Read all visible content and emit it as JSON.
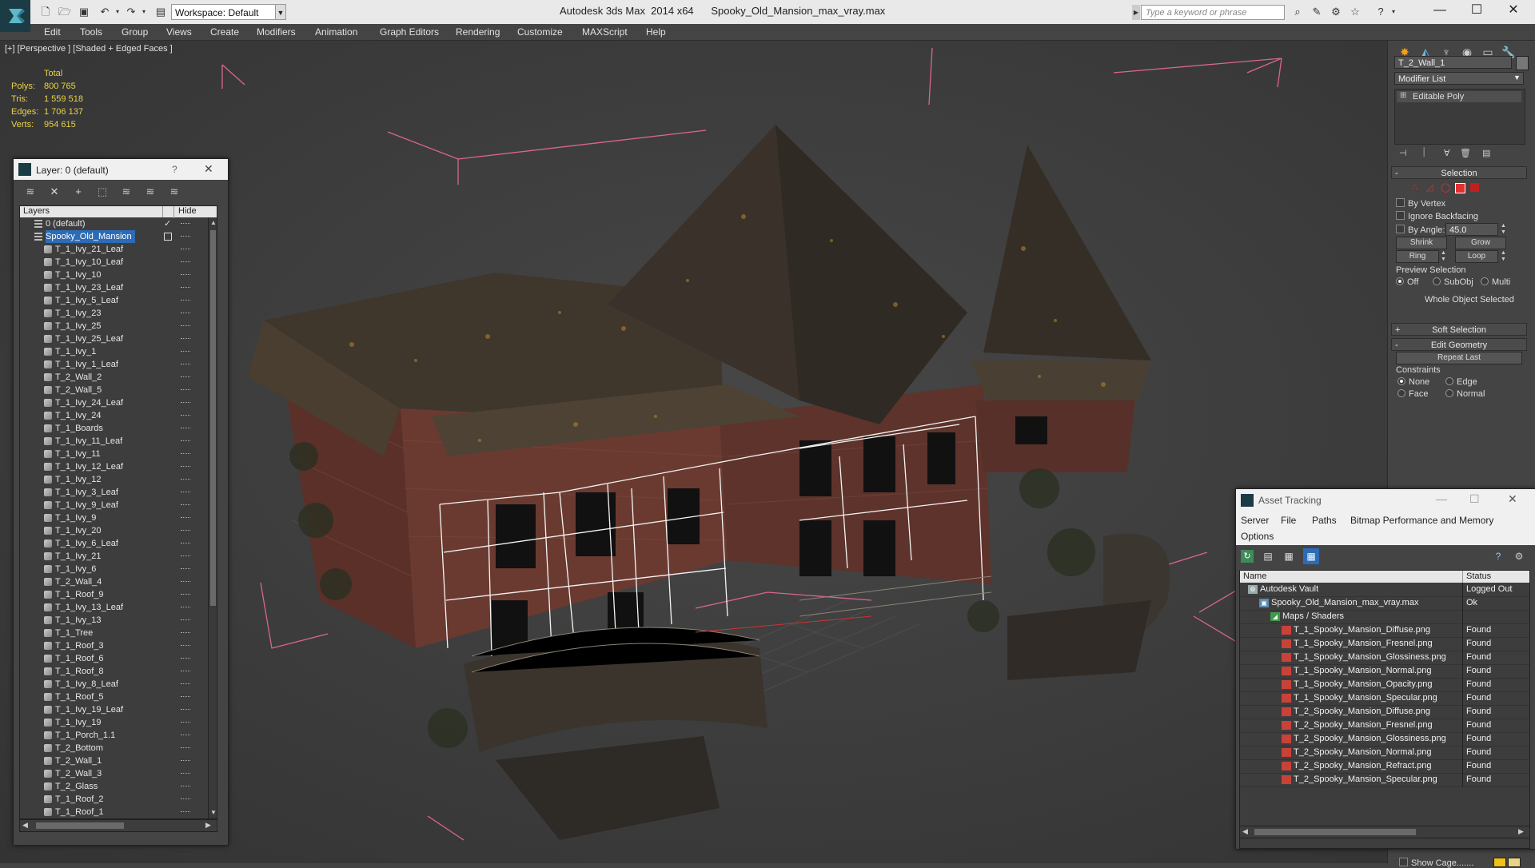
{
  "app": {
    "title": "Autodesk 3ds Max  2014 x64      Spooky_Old_Mansion_max_vray.max",
    "workspace": "Workspace: Default",
    "search_placeholder": "Type a keyword or phrase"
  },
  "menu": [
    "Edit",
    "Tools",
    "Group",
    "Views",
    "Create",
    "Modifiers",
    "Animation",
    "Graph Editors",
    "Rendering",
    "Customize",
    "MAXScript",
    "Help"
  ],
  "viewport": {
    "label": "[+] [Perspective ] [Shaded + Edged Faces ]",
    "stats": {
      "header": "Total",
      "rows": [
        {
          "key": "Polys:",
          "value": "800 765"
        },
        {
          "key": "Tris:",
          "value": "1 559 518"
        },
        {
          "key": "Edges:",
          "value": "1 706 137"
        },
        {
          "key": "Verts:",
          "value": "954 615"
        }
      ]
    }
  },
  "layer_dialog": {
    "title": "Layer: 0 (default)",
    "help": "?",
    "col_layers": "Layers",
    "col_hide": "Hide",
    "rows": [
      {
        "name": "0 (default)",
        "level": 1,
        "checked": true
      },
      {
        "name": "Spooky_Old_Mansion",
        "level": 1,
        "selected": true
      },
      {
        "name": "T_1_Ivy_21_Leaf",
        "level": 2
      },
      {
        "name": "T_1_Ivy_10_Leaf",
        "level": 2
      },
      {
        "name": "T_1_Ivy_10",
        "level": 2
      },
      {
        "name": "T_1_Ivy_23_Leaf",
        "level": 2
      },
      {
        "name": "T_1_Ivy_5_Leaf",
        "level": 2
      },
      {
        "name": "T_1_Ivy_23",
        "level": 2
      },
      {
        "name": "T_1_Ivy_25",
        "level": 2
      },
      {
        "name": "T_1_Ivy_25_Leaf",
        "level": 2
      },
      {
        "name": "T_1_Ivy_1",
        "level": 2
      },
      {
        "name": "T_1_Ivy_1_Leaf",
        "level": 2
      },
      {
        "name": "T_2_Wall_2",
        "level": 2
      },
      {
        "name": "T_2_Wall_5",
        "level": 2
      },
      {
        "name": "T_1_Ivy_24_Leaf",
        "level": 2
      },
      {
        "name": "T_1_Ivy_24",
        "level": 2
      },
      {
        "name": "T_1_Boards",
        "level": 2
      },
      {
        "name": "T_1_Ivy_11_Leaf",
        "level": 2
      },
      {
        "name": "T_1_Ivy_11",
        "level": 2
      },
      {
        "name": "T_1_Ivy_12_Leaf",
        "level": 2
      },
      {
        "name": "T_1_Ivy_12",
        "level": 2
      },
      {
        "name": "T_1_Ivy_3_Leaf",
        "level": 2
      },
      {
        "name": "T_1_Ivy_9_Leaf",
        "level": 2
      },
      {
        "name": "T_1_Ivy_9",
        "level": 2
      },
      {
        "name": "T_1_Ivy_20",
        "level": 2
      },
      {
        "name": "T_1_Ivy_6_Leaf",
        "level": 2
      },
      {
        "name": "T_1_Ivy_21",
        "level": 2
      },
      {
        "name": "T_1_Ivy_6",
        "level": 2
      },
      {
        "name": "T_2_Wall_4",
        "level": 2
      },
      {
        "name": "T_1_Roof_9",
        "level": 2
      },
      {
        "name": "T_1_Ivy_13_Leaf",
        "level": 2
      },
      {
        "name": "T_1_Ivy_13",
        "level": 2
      },
      {
        "name": "T_1_Tree",
        "level": 2
      },
      {
        "name": "T_1_Roof_3",
        "level": 2
      },
      {
        "name": "T_1_Roof_6",
        "level": 2
      },
      {
        "name": "T_1_Roof_8",
        "level": 2
      },
      {
        "name": "T_1_Ivy_8_Leaf",
        "level": 2
      },
      {
        "name": "T_1_Roof_5",
        "level": 2
      },
      {
        "name": "T_1_Ivy_19_Leaf",
        "level": 2
      },
      {
        "name": "T_1_Ivy_19",
        "level": 2
      },
      {
        "name": "T_1_Porch_1.1",
        "level": 2
      },
      {
        "name": "T_2_Bottom",
        "level": 2
      },
      {
        "name": "T_2_Wall_1",
        "level": 2
      },
      {
        "name": "T_2_Wall_3",
        "level": 2
      },
      {
        "name": "T_2_Glass",
        "level": 2
      },
      {
        "name": "T_1_Roof_2",
        "level": 2
      },
      {
        "name": "T_1_Roof_1",
        "level": 2
      }
    ]
  },
  "command_panel": {
    "object_name": "T_2_Wall_1",
    "modifier_list": "Modifier List",
    "stack_item": "Editable Poly",
    "selection": {
      "title": "Selection",
      "by_vertex": "By Vertex",
      "ignore_backfacing": "Ignore Backfacing",
      "by_angle": "By Angle:",
      "angle_value": "45.0",
      "shrink": "Shrink",
      "grow": "Grow",
      "ring": "Ring",
      "loop": "Loop",
      "preview_title": "Preview Selection",
      "preview_opts": [
        "Off",
        "SubObj",
        "Multi"
      ],
      "status": "Whole Object Selected"
    },
    "soft_selection": "Soft Selection",
    "edit_geometry": {
      "title": "Edit Geometry",
      "repeat_last": "Repeat Last",
      "constraints": "Constraints",
      "opts": [
        "None",
        "Edge",
        "Face",
        "Normal"
      ]
    },
    "show_cage": "Show Cage......."
  },
  "asset_tracking": {
    "title": "Asset Tracking",
    "menu": [
      "Server",
      "File",
      "Paths",
      "Bitmap Performance and Memory",
      "Options"
    ],
    "col_name": "Name",
    "col_status": "Status",
    "rows": [
      {
        "name": "Autodesk Vault",
        "status": "Logged Out",
        "level": 0,
        "icon": "vault"
      },
      {
        "name": "Spooky_Old_Mansion_max_vray.max",
        "status": "Ok",
        "level": 1,
        "icon": "max"
      },
      {
        "name": "Maps / Shaders",
        "status": "",
        "level": 2,
        "icon": "maps"
      },
      {
        "name": "T_1_Spooky_Mansion_Diffuse.png",
        "status": "Found",
        "level": 3,
        "icon": "png"
      },
      {
        "name": "T_1_Spooky_Mansion_Fresnel.png",
        "status": "Found",
        "level": 3,
        "icon": "png"
      },
      {
        "name": "T_1_Spooky_Mansion_Glossiness.png",
        "status": "Found",
        "level": 3,
        "icon": "png"
      },
      {
        "name": "T_1_Spooky_Mansion_Normal.png",
        "status": "Found",
        "level": 3,
        "icon": "png"
      },
      {
        "name": "T_1_Spooky_Mansion_Opacity.png",
        "status": "Found",
        "level": 3,
        "icon": "png"
      },
      {
        "name": "T_1_Spooky_Mansion_Specular.png",
        "status": "Found",
        "level": 3,
        "icon": "png"
      },
      {
        "name": "T_2_Spooky_Mansion_Diffuse.png",
        "status": "Found",
        "level": 3,
        "icon": "png"
      },
      {
        "name": "T_2_Spooky_Mansion_Fresnel.png",
        "status": "Found",
        "level": 3,
        "icon": "png"
      },
      {
        "name": "T_2_Spooky_Mansion_Glossiness.png",
        "status": "Found",
        "level": 3,
        "icon": "png"
      },
      {
        "name": "T_2_Spooky_Mansion_Normal.png",
        "status": "Found",
        "level": 3,
        "icon": "png"
      },
      {
        "name": "T_2_Spooky_Mansion_Refract.png",
        "status": "Found",
        "level": 3,
        "icon": "png"
      },
      {
        "name": "T_2_Spooky_Mansion_Specular.png",
        "status": "Found",
        "level": 3,
        "icon": "png"
      }
    ]
  },
  "colors": {
    "stats_yellow": "#e8d24a",
    "selection_blue": "#2d6bb4",
    "bbox_pink": "#d9668f",
    "subobj_red": "#e03030"
  }
}
